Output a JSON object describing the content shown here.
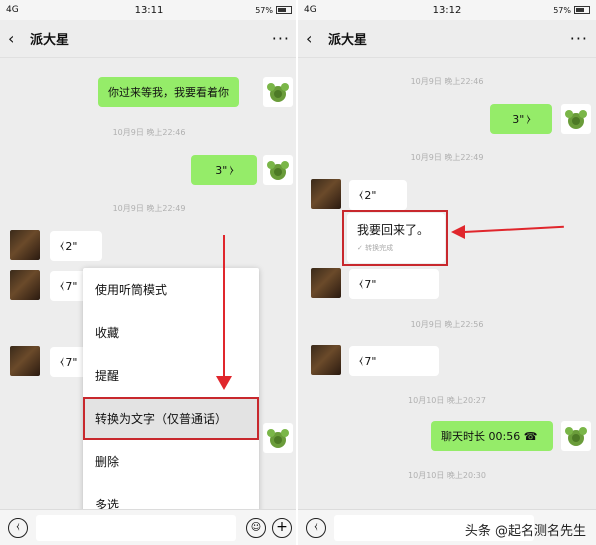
{
  "left": {
    "status": {
      "network": "4G",
      "time": "13:11",
      "battery": "57%"
    },
    "title": "派大星",
    "timestamps": [
      "10月9日 晚上22:46",
      "10月9日 晚上22:49"
    ],
    "messages": {
      "sent_text": "你过来等我，我要看着你",
      "sent_voice": "3\"",
      "recv_voice_1": "2\"",
      "recv_voice_2": "7\"",
      "recv_voice_3": "7\""
    },
    "menu": [
      "使用听筒模式",
      "收藏",
      "提醒",
      "转换为文字（仅普通话）",
      "删除",
      "多选"
    ]
  },
  "right": {
    "status": {
      "network": "4G",
      "time": "13:12",
      "battery": "57%"
    },
    "title": "派大星",
    "timestamps": [
      "10月9日 晚上22:46",
      "10月9日 晚上22:49",
      "10月9日 晚上22:56",
      "10月10日 晚上20:27",
      "10月10日 晚上20:30"
    ],
    "messages": {
      "sent_voice": "3\"",
      "recv_voice_1": "2\"",
      "transcript_text": "我要回来了。",
      "transcript_status": "转换完成",
      "recv_voice_2": "7\"",
      "recv_voice_3": "7\"",
      "call_text": "聊天时长 00:56"
    }
  },
  "watermark": "头条 @起名测名先生",
  "icons": {
    "back": "chevron-left-icon",
    "more": "more-dots-icon",
    "voice": "voice-wave-icon",
    "phone": "phone-hangup-icon",
    "plus": "plus-circle-icon",
    "emoji": "emoji-icon"
  },
  "colors": {
    "sent_bubble": "#95ec69",
    "received_bubble": "#ffffff",
    "highlight": "#c8282d",
    "arrow": "#e0262c",
    "chat_bg": "#ededed"
  }
}
